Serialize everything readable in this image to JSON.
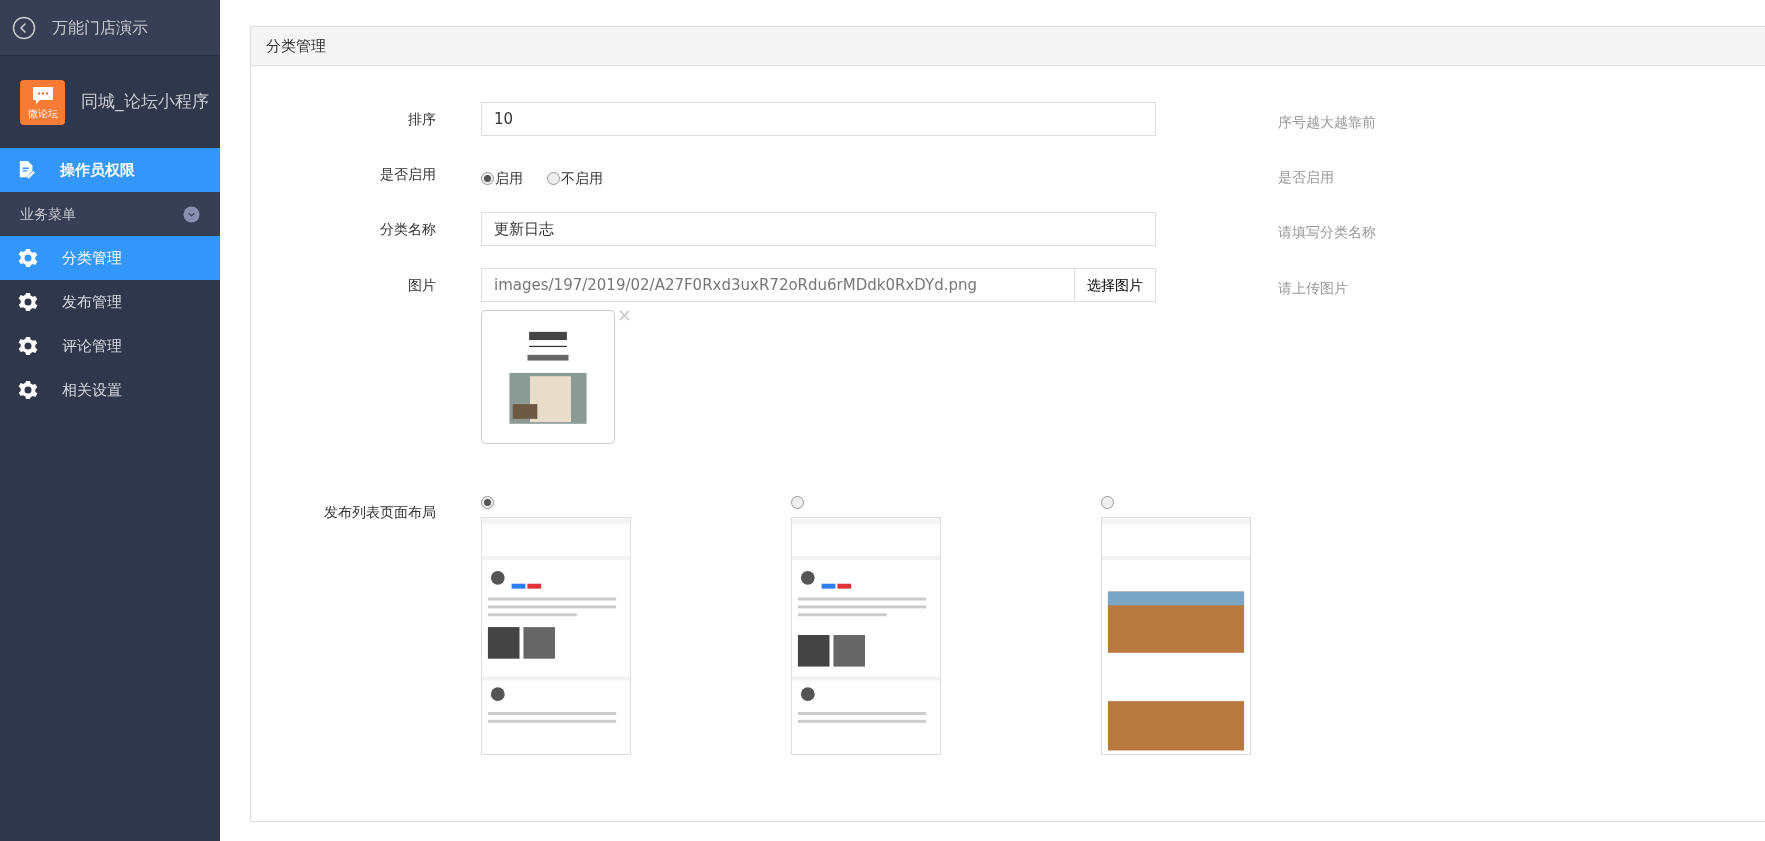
{
  "sidebar": {
    "back_title": "万能门店演示",
    "app": {
      "name": "同城_论坛小程序",
      "logo_text": "微论坛"
    },
    "items": [
      {
        "kind": "link",
        "label": "操作员权限",
        "selected": true
      },
      {
        "kind": "section",
        "label": "业务菜单",
        "expanded": true
      },
      {
        "kind": "menu",
        "label": "分类管理",
        "selected": true
      },
      {
        "kind": "menu",
        "label": "发布管理",
        "selected": false
      },
      {
        "kind": "menu",
        "label": "评论管理",
        "selected": false
      },
      {
        "kind": "menu",
        "label": "相关设置",
        "selected": false
      }
    ]
  },
  "panel": {
    "title": "分类管理",
    "fields": [
      {
        "kind": "text",
        "label": "排序",
        "value": "10",
        "hint": "序号越大越靠前"
      },
      {
        "kind": "radio",
        "label": "是否启用",
        "options": [
          {
            "label": "启用",
            "selected": true
          },
          {
            "label": "不启用",
            "selected": false
          }
        ],
        "hint": "是否启用"
      },
      {
        "kind": "text",
        "label": "分类名称",
        "value": "更新日志",
        "hint": "请填写分类名称"
      },
      {
        "kind": "image",
        "label": "图片",
        "value": "images/197/2019/02/A27F0Rxd3uxR72oRdu6rMDdk0RxDYd.png",
        "button": "选择图片",
        "hint": "请上传图片"
      },
      {
        "kind": "layout",
        "label": "发布列表页面布局",
        "options": [
          {
            "selected": true
          },
          {
            "selected": false
          },
          {
            "selected": false
          }
        ]
      }
    ]
  }
}
